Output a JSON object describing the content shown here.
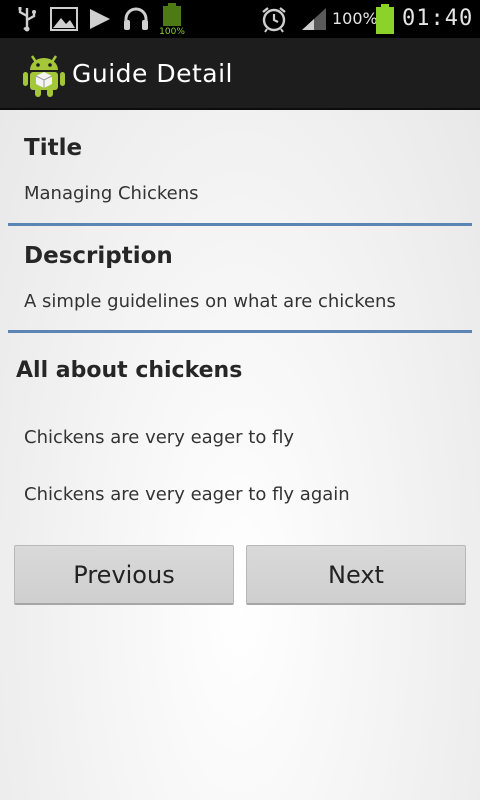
{
  "status_bar": {
    "battery_percent": "100%",
    "time": "01:40",
    "left_icons": [
      "usb-icon",
      "image-icon",
      "play-icon",
      "headset-icon",
      "battery-small-icon"
    ],
    "right_icons": [
      "alarm-icon",
      "signal-icon",
      "battery-icon"
    ],
    "small_battery_label": "100%"
  },
  "action_bar": {
    "title": "Guide Detail",
    "icon": "android-icon"
  },
  "guide": {
    "title_label": "Title",
    "title_value": "Managing Chickens",
    "description_label": "Description",
    "description_value": "A simple guidelines on what are chickens",
    "steps_heading": "All about chickens",
    "steps": [
      "Chickens are very eager to fly",
      "Chickens are very eager to fly again"
    ]
  },
  "buttons": {
    "previous": "Previous",
    "next": "Next"
  },
  "colors": {
    "divider": "#5b86b3",
    "action_bar": "#1d1d1d",
    "battery_green": "#8bd32a"
  }
}
